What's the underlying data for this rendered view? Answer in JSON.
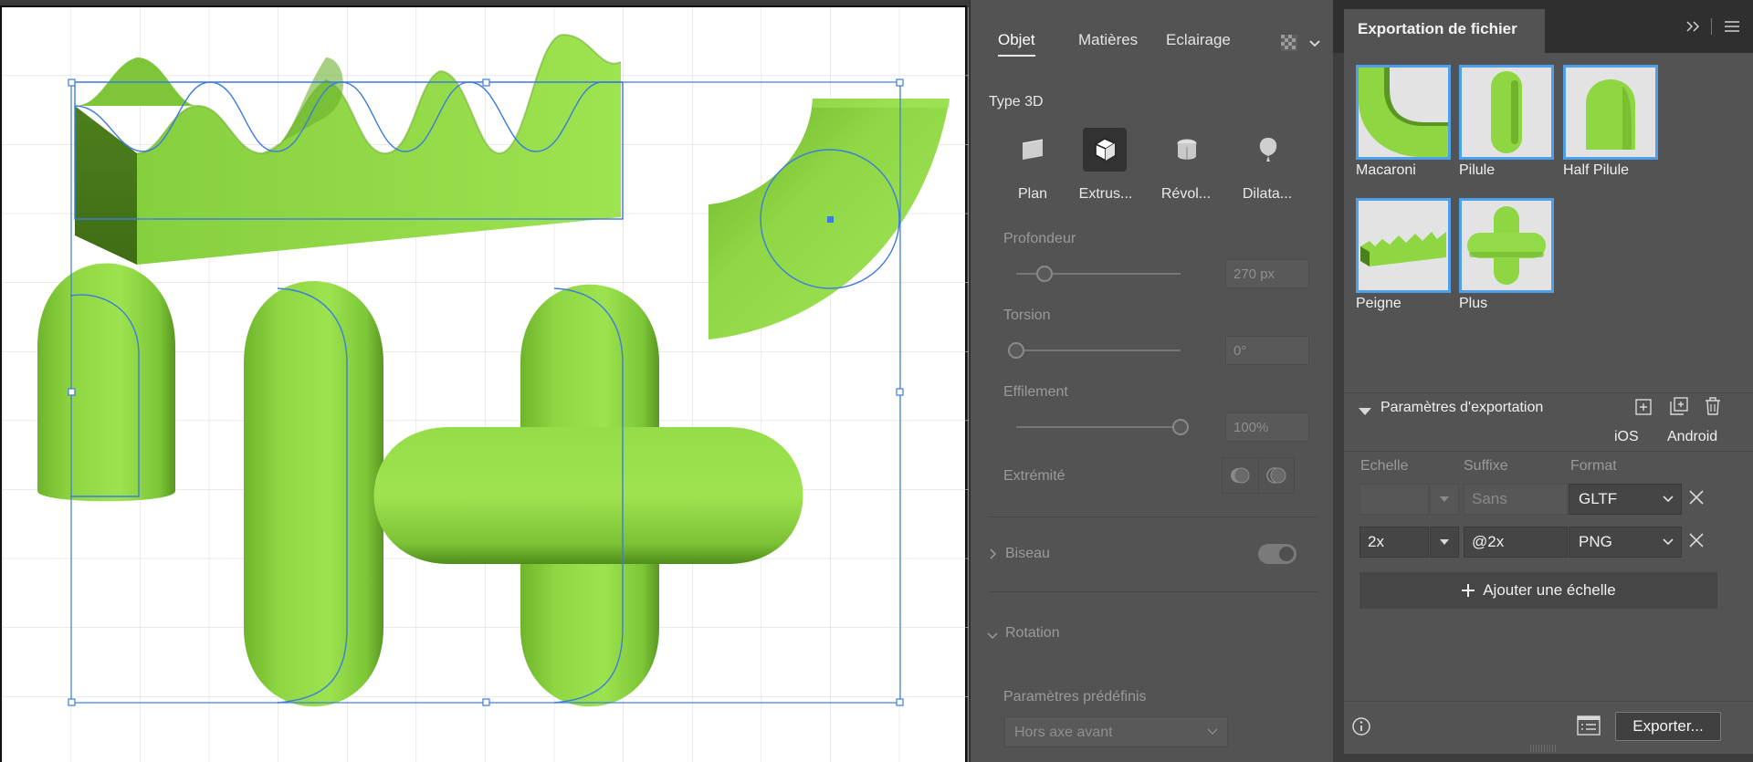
{
  "panel3d": {
    "tabs": [
      "Objet",
      "Matières",
      "Eclairage"
    ],
    "active_tab": "Objet",
    "type_heading": "Type 3D",
    "types": [
      {
        "label": "Plan",
        "icon": "plane-icon",
        "active": false
      },
      {
        "label": "Extrus...",
        "icon": "extrude-icon",
        "active": true
      },
      {
        "label": "Révol...",
        "icon": "revolve-icon",
        "active": false
      },
      {
        "label": "Dilata...",
        "icon": "inflate-icon",
        "active": false
      }
    ],
    "depth": {
      "label": "Profondeur",
      "value": "270 px",
      "level": 0.17
    },
    "twist": {
      "label": "Torsion",
      "value": "0°",
      "level": 0.0
    },
    "taper": {
      "label": "Effilement",
      "value": "100%",
      "level": 1.0
    },
    "cap_label": "Extrémité",
    "bevel_label": "Biseau",
    "bevel_on": true,
    "rotation_label": "Rotation",
    "presets_label": "Paramètres prédéfinis",
    "preset_value": "Hors axe avant"
  },
  "export": {
    "title": "Exportation de fichier",
    "assets": [
      {
        "name": "Macaroni",
        "icon": "macaroni-thumbnail"
      },
      {
        "name": "Pilule",
        "icon": "pill-thumbnail"
      },
      {
        "name": "Half Pilule",
        "icon": "half-pill-thumbnail"
      },
      {
        "name": "Peigne",
        "icon": "comb-thumbnail"
      },
      {
        "name": "Plus",
        "icon": "plus-thumbnail"
      }
    ],
    "settings_label": "Paramètres d'exportation",
    "platforms": [
      "iOS",
      "Android"
    ],
    "columns": [
      "Echelle",
      "Suffixe",
      "Format"
    ],
    "rows": [
      {
        "scale": "",
        "suffix": "",
        "suffix_placeholder": "Sans",
        "format": "GLTF",
        "disabled": true
      },
      {
        "scale": "2x",
        "suffix": "@2x",
        "suffix_placeholder": "",
        "format": "PNG",
        "disabled": false
      }
    ],
    "add_scale_label": "Ajouter une échelle",
    "export_button": "Exporter..."
  },
  "colors": {
    "shape_green": "#8ed642",
    "selection_blue": "#3d7be0",
    "asset_highlight": "#4f9fe8"
  }
}
